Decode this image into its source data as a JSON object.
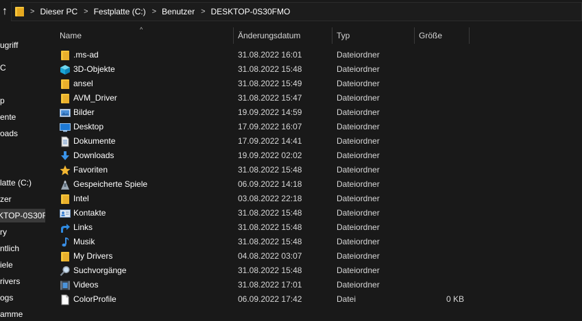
{
  "address_bar": {
    "up_glyph": "↑",
    "separator": ">",
    "breadcrumbs": [
      "Dieser PC",
      "Festplatte (C:)",
      "Benutzer",
      "DESKTOP-0S30FMO"
    ]
  },
  "nav_pane": {
    "items": [
      {
        "label": "ugriff"
      },
      {
        "label": "C"
      },
      {
        "label": "p"
      },
      {
        "label": "ente"
      },
      {
        "label": "oads"
      },
      {
        "label": "latte (C:)"
      },
      {
        "label": "zer"
      },
      {
        "label": "KTOP-0S30FM",
        "selected": true
      },
      {
        "label": "ry"
      },
      {
        "label": "ntlich"
      },
      {
        "label": "iele"
      },
      {
        "label": "rivers"
      },
      {
        "label": "ogs"
      },
      {
        "label": "amme"
      }
    ]
  },
  "columns": {
    "name": "Name",
    "date": "Änderungsdatum",
    "type": "Typ",
    "size": "Größe",
    "sort_glyph": "^"
  },
  "files": [
    {
      "name": ".ms-ad",
      "date": "31.08.2022 16:01",
      "type": "Dateiordner",
      "size": "",
      "icon": "folder-icon"
    },
    {
      "name": "3D-Objekte",
      "date": "31.08.2022 15:48",
      "type": "Dateiordner",
      "size": "",
      "icon": "3d-objects-icon"
    },
    {
      "name": "ansel",
      "date": "31.08.2022 15:49",
      "type": "Dateiordner",
      "size": "",
      "icon": "folder-icon"
    },
    {
      "name": "AVM_Driver",
      "date": "31.08.2022 15:47",
      "type": "Dateiordner",
      "size": "",
      "icon": "folder-icon"
    },
    {
      "name": "Bilder",
      "date": "19.09.2022 14:59",
      "type": "Dateiordner",
      "size": "",
      "icon": "pictures-icon"
    },
    {
      "name": "Desktop",
      "date": "17.09.2022 16:07",
      "type": "Dateiordner",
      "size": "",
      "icon": "desktop-icon"
    },
    {
      "name": "Dokumente",
      "date": "17.09.2022 14:41",
      "type": "Dateiordner",
      "size": "",
      "icon": "documents-icon"
    },
    {
      "name": "Downloads",
      "date": "19.09.2022 02:02",
      "type": "Dateiordner",
      "size": "",
      "icon": "downloads-icon"
    },
    {
      "name": "Favoriten",
      "date": "31.08.2022 15:48",
      "type": "Dateiordner",
      "size": "",
      "icon": "favorites-icon"
    },
    {
      "name": "Gespeicherte Spiele",
      "date": "06.09.2022 14:18",
      "type": "Dateiordner",
      "size": "",
      "icon": "saved-games-icon"
    },
    {
      "name": "Intel",
      "date": "03.08.2022 22:18",
      "type": "Dateiordner",
      "size": "",
      "icon": "folder-icon"
    },
    {
      "name": "Kontakte",
      "date": "31.08.2022 15:48",
      "type": "Dateiordner",
      "size": "",
      "icon": "contacts-icon"
    },
    {
      "name": "Links",
      "date": "31.08.2022 15:48",
      "type": "Dateiordner",
      "size": "",
      "icon": "links-icon"
    },
    {
      "name": "Musik",
      "date": "31.08.2022 15:48",
      "type": "Dateiordner",
      "size": "",
      "icon": "music-icon"
    },
    {
      "name": "My Drivers",
      "date": "04.08.2022 03:07",
      "type": "Dateiordner",
      "size": "",
      "icon": "folder-icon"
    },
    {
      "name": "Suchvorgänge",
      "date": "31.08.2022 15:48",
      "type": "Dateiordner",
      "size": "",
      "icon": "searches-icon"
    },
    {
      "name": "Videos",
      "date": "31.08.2022 17:01",
      "type": "Dateiordner",
      "size": "",
      "icon": "videos-icon"
    },
    {
      "name": "ColorProfile",
      "date": "06.09.2022 17:42",
      "type": "Datei",
      "size": "0 KB",
      "icon": "file-icon"
    }
  ],
  "colors": {
    "background": "#191919",
    "folder": "#f5c43a",
    "selected": "#3a3a3a",
    "text": "#ffffff",
    "text_secondary": "#d7d7d7"
  }
}
